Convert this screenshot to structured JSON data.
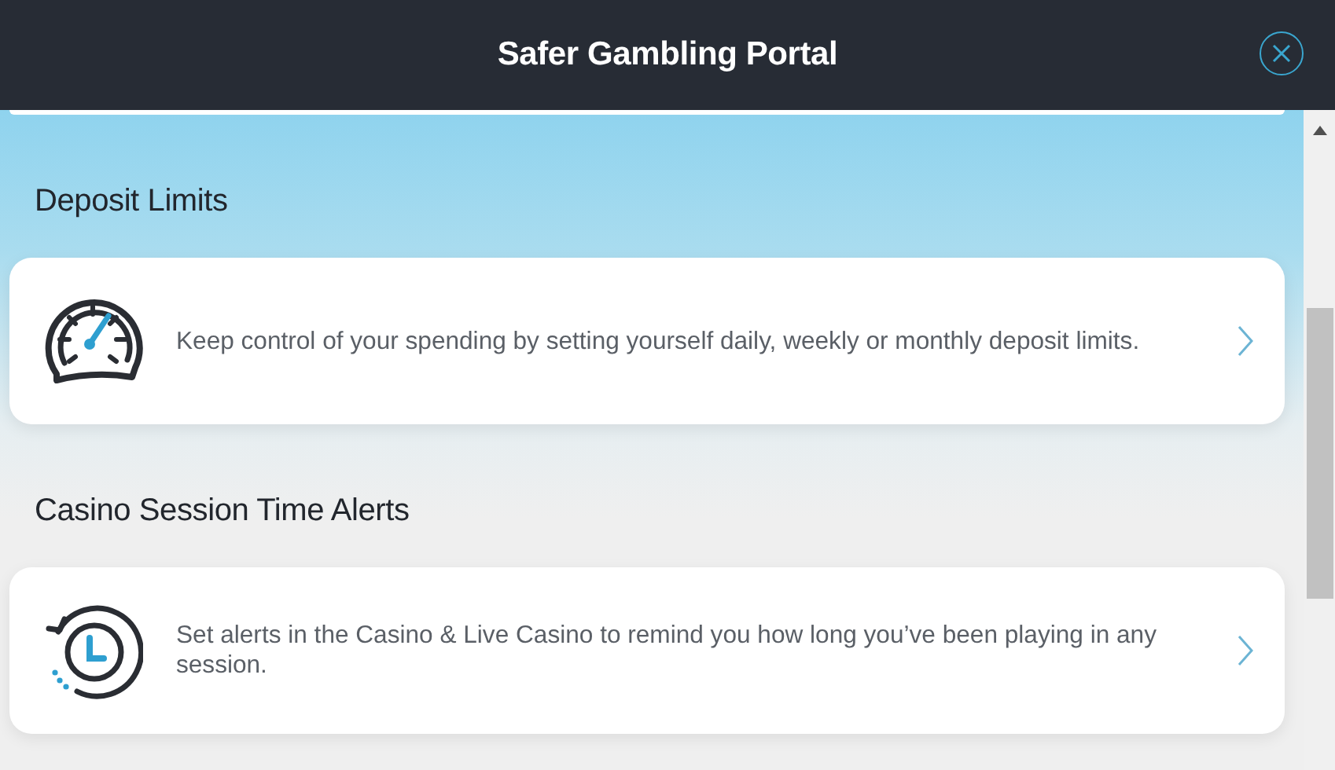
{
  "window": {
    "title": "Safer Gambling Portal"
  },
  "sections": [
    {
      "title": "Deposit Limits",
      "kind": "gauge",
      "description": "Keep control of your spending by setting yourself daily, weekly or monthly deposit limits."
    },
    {
      "title": "Casino Session Time Alerts",
      "kind": "clock",
      "description": "Set alerts in the Casino & Live Casino to remind you how long you’ve been playing in any session."
    }
  ]
}
